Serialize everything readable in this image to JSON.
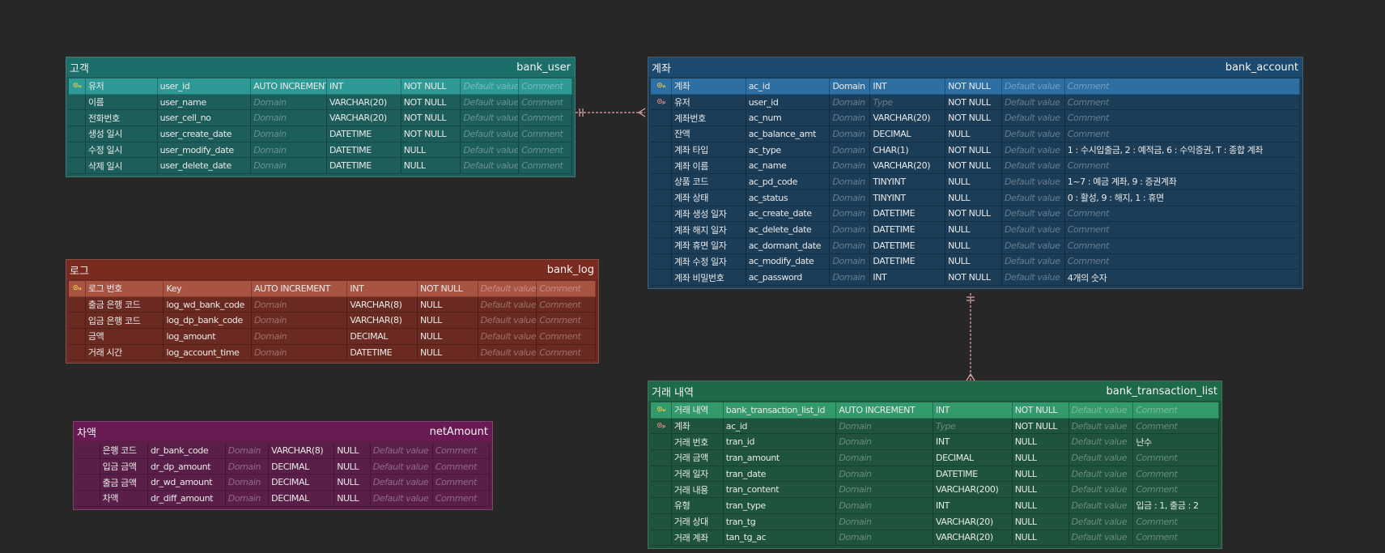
{
  "theme": {
    "background": "#272727",
    "relationship_color": "#e3a9a9"
  },
  "tables": [
    {
      "name": "bank_user",
      "alias": "고객",
      "colors": {
        "header": "#1c6e6b",
        "body": "#1d5d5a",
        "pk_row": "#2e9a96"
      },
      "columns": [
        {
          "key": "pk",
          "logical": "유저",
          "physical": "user_id",
          "domain": "AUTO INCREMENT",
          "type": "INT",
          "nullable": "NOT NULL",
          "default": "Default value",
          "comment": "Comment"
        },
        {
          "key": "",
          "logical": "이름",
          "physical": "user_name",
          "domain": "Domain",
          "type": "VARCHAR(20)",
          "nullable": "NOT NULL",
          "default": "Default value",
          "comment": "Comment"
        },
        {
          "key": "",
          "logical": "전화번호",
          "physical": "user_cell_no",
          "domain": "Domain",
          "type": "VARCHAR(20)",
          "nullable": "NOT NULL",
          "default": "Default value",
          "comment": "Comment"
        },
        {
          "key": "",
          "logical": "생성 일시",
          "physical": "user_create_date",
          "domain": "Domain",
          "type": "DATETIME",
          "nullable": "NOT NULL",
          "default": "Default value",
          "comment": "Comment"
        },
        {
          "key": "",
          "logical": "수정 일시",
          "physical": "user_modify_date",
          "domain": "Domain",
          "type": "DATETIME",
          "nullable": "NULL",
          "default": "Default value",
          "comment": "Comment"
        },
        {
          "key": "",
          "logical": "삭제 일시",
          "physical": "user_delete_date",
          "domain": "Domain",
          "type": "DATETIME",
          "nullable": "NULL",
          "default": "Default value",
          "comment": "Comment"
        }
      ]
    },
    {
      "name": "bank_log",
      "alias": "로그",
      "colors": {
        "header": "#7a2a1e",
        "body": "#6a2a22",
        "pk_row": "#a95442"
      },
      "columns": [
        {
          "key": "pk",
          "logical": "로그 번호",
          "physical": "Key",
          "domain": "AUTO INCREMENT",
          "type": "INT",
          "nullable": "NOT NULL",
          "default": "Default value",
          "comment": "Comment"
        },
        {
          "key": "",
          "logical": "출금 은행 코드",
          "physical": "log_wd_bank_code",
          "domain": "Domain",
          "type": "VARCHAR(8)",
          "nullable": "NULL",
          "default": "Default value",
          "comment": "Comment"
        },
        {
          "key": "",
          "logical": "입금 은행 코드",
          "physical": "log_dp_bank_code",
          "domain": "Domain",
          "type": "VARCHAR(8)",
          "nullable": "NULL",
          "default": "Default value",
          "comment": "Comment"
        },
        {
          "key": "",
          "logical": "금액",
          "physical": "log_amount",
          "domain": "Domain",
          "type": "DECIMAL",
          "nullable": "NULL",
          "default": "Default value",
          "comment": "Comment"
        },
        {
          "key": "",
          "logical": "거래 시간",
          "physical": "log_account_time",
          "domain": "Domain",
          "type": "DATETIME",
          "nullable": "NULL",
          "default": "Default value",
          "comment": "Comment"
        }
      ]
    },
    {
      "name": "netAmount",
      "alias": "차액",
      "colors": {
        "header": "#6a1a52",
        "body": "#5a1f48",
        "pk_row": "#5a1f48"
      },
      "columns": [
        {
          "key": "",
          "logical": "은행 코드",
          "physical": "dr_bank_code",
          "domain": "Domain",
          "type": "VARCHAR(8)",
          "nullable": "NULL",
          "default": "Default value",
          "comment": "Comment"
        },
        {
          "key": "",
          "logical": "입금 금액",
          "physical": "dr_dp_amount",
          "domain": "Domain",
          "type": "DECIMAL",
          "nullable": "NULL",
          "default": "Default value",
          "comment": "Comment"
        },
        {
          "key": "",
          "logical": "출금 금액",
          "physical": "dr_wd_amount",
          "domain": "Domain",
          "type": "DECIMAL",
          "nullable": "NULL",
          "default": "Default value",
          "comment": "Comment"
        },
        {
          "key": "",
          "logical": "차액",
          "physical": "dr_diff_amount",
          "domain": "Domain",
          "type": "DECIMAL",
          "nullable": "NULL",
          "default": "Default value",
          "comment": "Comment"
        }
      ]
    },
    {
      "name": "bank_account",
      "alias": "계좌",
      "colors": {
        "header": "#1b4a6e",
        "body": "#1c3d57",
        "pk_row": "#2d6fa3"
      },
      "columns": [
        {
          "key": "pk",
          "logical": "계좌",
          "physical": "ac_id",
          "domain": "Domain",
          "type": "INT",
          "nullable": "NOT NULL",
          "default": "Default value",
          "comment": "Comment"
        },
        {
          "key": "fk",
          "logical": "유저",
          "physical": "user_id",
          "domain": "Domain",
          "type": "Type",
          "nullable": "NOT NULL",
          "default": "Default value",
          "comment": "Comment"
        },
        {
          "key": "",
          "logical": "계좌번호",
          "physical": "ac_num",
          "domain": "Domain",
          "type": "VARCHAR(20)",
          "nullable": "NOT NULL",
          "default": "Default value",
          "comment": "Comment"
        },
        {
          "key": "",
          "logical": "잔액",
          "physical": "ac_balance_amt",
          "domain": "Domain",
          "type": "DECIMAL",
          "nullable": "NULL",
          "default": "Default value",
          "comment": "Comment"
        },
        {
          "key": "",
          "logical": "계좌 타입",
          "physical": "ac_type",
          "domain": "Domain",
          "type": "CHAR(1)",
          "nullable": "NOT NULL",
          "default": "Default value",
          "comment": "1 : 수시입출금, 2 : 예적금, 6 : 수익증권, T : 종합 계좌"
        },
        {
          "key": "",
          "logical": "계좌 이름",
          "physical": "ac_name",
          "domain": "Domain",
          "type": "VARCHAR(20)",
          "nullable": "NOT NULL",
          "default": "Default value",
          "comment": "Comment"
        },
        {
          "key": "",
          "logical": "상품 코드",
          "physical": "ac_pd_code",
          "domain": "Domain",
          "type": "TINYINT",
          "nullable": "NULL",
          "default": "Default value",
          "comment": "1~7 : 예금 계좌, 9 : 증권계좌"
        },
        {
          "key": "",
          "logical": "계좌 상태",
          "physical": "ac_status",
          "domain": "Domain",
          "type": "TINYINT",
          "nullable": "NULL",
          "default": "Default value",
          "comment": "0 : 활성, 9 : 해지, 1 : 휴면"
        },
        {
          "key": "",
          "logical": "계좌 생성 일자",
          "physical": "ac_create_date",
          "domain": "Domain",
          "type": "DATETIME",
          "nullable": "NOT NULL",
          "default": "Default value",
          "comment": "Comment"
        },
        {
          "key": "",
          "logical": "계좌 해지 일자",
          "physical": "ac_delete_date",
          "domain": "Domain",
          "type": "DATETIME",
          "nullable": "NULL",
          "default": "Default value",
          "comment": "Comment"
        },
        {
          "key": "",
          "logical": "계좌 휴면 일자",
          "physical": "ac_dormant_date",
          "domain": "Domain",
          "type": "DATETIME",
          "nullable": "NULL",
          "default": "Default value",
          "comment": "Comment"
        },
        {
          "key": "",
          "logical": "계좌 수정 일자",
          "physical": "ac_modify_date",
          "domain": "Domain",
          "type": "DATETIME",
          "nullable": "NULL",
          "default": "Default value",
          "comment": "Comment"
        },
        {
          "key": "",
          "logical": "계좌 비밀번호",
          "physical": "ac_password",
          "domain": "Domain",
          "type": "INT",
          "nullable": "NOT NULL",
          "default": "Default value",
          "comment": "4개의 숫자"
        }
      ]
    },
    {
      "name": "bank_transaction_list",
      "alias": "거래 내역",
      "colors": {
        "header": "#1e6a48",
        "body": "#1e533c",
        "pk_row": "#339a6b"
      },
      "columns": [
        {
          "key": "pk",
          "logical": "거래 내역",
          "physical": "bank_transaction_list_id",
          "domain": "AUTO INCREMENT",
          "type": "INT",
          "nullable": "NOT NULL",
          "default": "Default value",
          "comment": "Comment"
        },
        {
          "key": "fk",
          "logical": "계좌",
          "physical": "ac_id",
          "domain": "Domain",
          "type": "Type",
          "nullable": "NOT NULL",
          "default": "Default value",
          "comment": "Comment"
        },
        {
          "key": "",
          "logical": "거래 번호",
          "physical": "tran_id",
          "domain": "Domain",
          "type": "INT",
          "nullable": "NULL",
          "default": "Default value",
          "comment": "난수"
        },
        {
          "key": "",
          "logical": "거래 금액",
          "physical": "tran_amount",
          "domain": "Domain",
          "type": "DECIMAL",
          "nullable": "NULL",
          "default": "Default value",
          "comment": "Comment"
        },
        {
          "key": "",
          "logical": "거래 일자",
          "physical": "tran_date",
          "domain": "Domain",
          "type": "DATETIME",
          "nullable": "NULL",
          "default": "Default value",
          "comment": "Comment"
        },
        {
          "key": "",
          "logical": "거래 내용",
          "physical": "tran_content",
          "domain": "Domain",
          "type": "VARCHAR(200)",
          "nullable": "NULL",
          "default": "Default value",
          "comment": "Comment"
        },
        {
          "key": "",
          "logical": "유형",
          "physical": "tran_type",
          "domain": "Domain",
          "type": "INT",
          "nullable": "NULL",
          "default": "Default value",
          "comment": "입금 : 1, 출금 : 2"
        },
        {
          "key": "",
          "logical": "거래 상대",
          "physical": "tran_tg",
          "domain": "Domain",
          "type": "VARCHAR(20)",
          "nullable": "NULL",
          "default": "Default value",
          "comment": "Comment"
        },
        {
          "key": "",
          "logical": "거래 계좌",
          "physical": "tan_tg_ac",
          "domain": "Domain",
          "type": "VARCHAR(20)",
          "nullable": "NULL",
          "default": "Default value",
          "comment": "Comment"
        }
      ]
    }
  ],
  "relationships": [
    {
      "from": "bank_user",
      "to": "bank_account"
    },
    {
      "from": "bank_account",
      "to": "bank_transaction_list"
    }
  ]
}
